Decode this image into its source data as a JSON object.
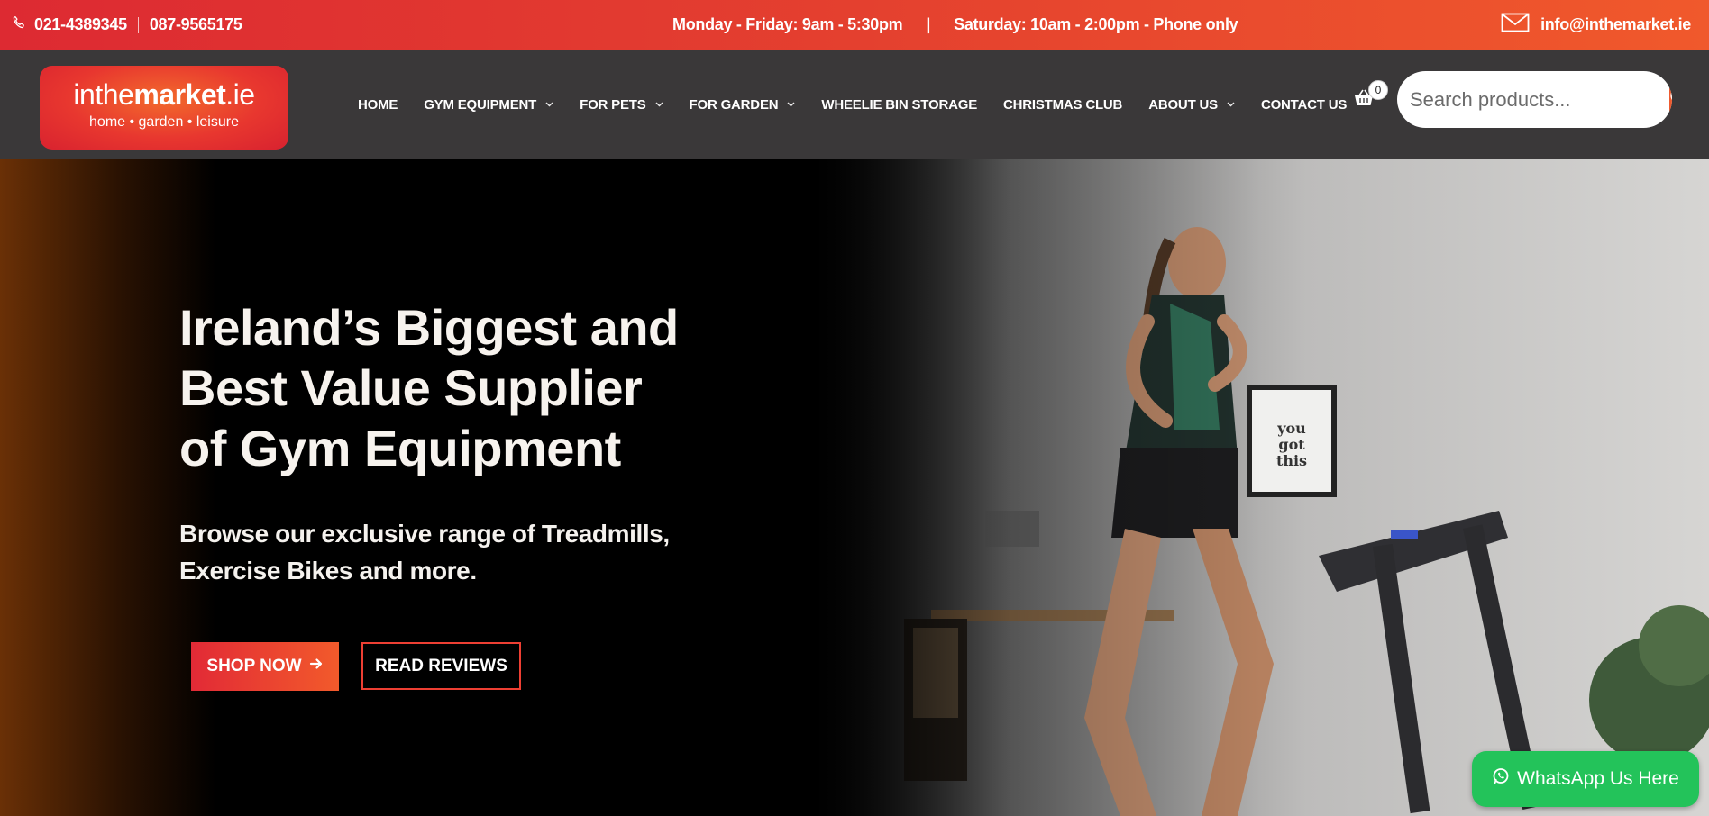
{
  "topbar": {
    "phone_icon": "phone-icon",
    "phone1": "021-4389345",
    "phone2": "087-9565175",
    "hours_weekday": "Monday - Friday: 9am - 5:30pm",
    "divider": "|",
    "hours_saturday": "Saturday: 10am - 2:00pm - Phone only",
    "email_icon": "envelope-icon",
    "email": "info@inthemarket.ie"
  },
  "logo": {
    "brand_light": "inthe",
    "brand_bold": "market",
    "brand_suffix": ".ie",
    "tagline": "home • garden • leisure"
  },
  "nav": {
    "items": [
      {
        "label": "HOME",
        "has_dropdown": false
      },
      {
        "label": "GYM EQUIPMENT",
        "has_dropdown": true
      },
      {
        "label": "FOR PETS",
        "has_dropdown": true
      },
      {
        "label": "FOR GARDEN",
        "has_dropdown": true
      },
      {
        "label": "WHEELIE BIN STORAGE",
        "has_dropdown": false
      },
      {
        "label": "CHRISTMAS CLUB",
        "has_dropdown": false
      },
      {
        "label": "ABOUT US",
        "has_dropdown": true
      },
      {
        "label": "CONTACT US",
        "has_dropdown": false
      }
    ],
    "chevron": "⌄",
    "cart_icon": "basket-icon",
    "cart_count": "0",
    "search_placeholder": "Search products...",
    "search_icon": "search-icon"
  },
  "hero": {
    "heading": "Ireland’s Biggest and Best Value Supplier of Gym Equipment",
    "subheading": "Browse our exclusive range of Treadmills, Exercise Bikes and more.",
    "shop_label": "SHOP NOW",
    "shop_icon": "arrow-right-icon",
    "reviews_label": "READ REVIEWS",
    "image": "woman running on treadmill"
  },
  "whatsapp": {
    "icon": "whatsapp-icon",
    "label": "WhatsApp Us Here"
  },
  "colors": {
    "brand_red": "#e22a36",
    "brand_orange": "#f25a2b",
    "nav_bg": "#3a3839",
    "whatsapp_green": "#23c35a"
  }
}
